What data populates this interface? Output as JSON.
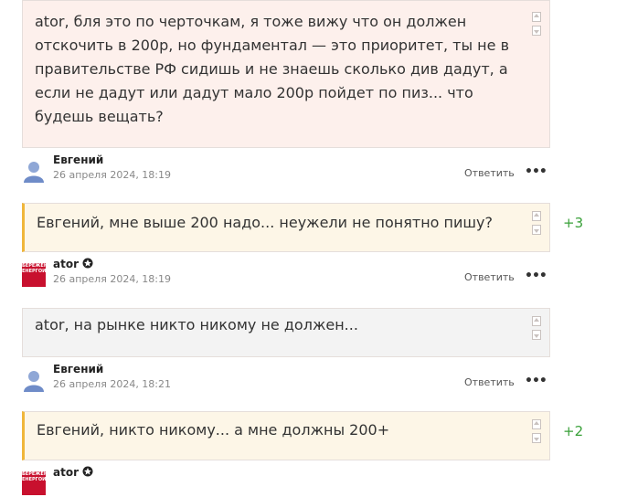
{
  "comments": [
    {
      "text_lines": [
        "ator, бля это по черточкам, я тоже вижу что он должен",
        "отскочить в 200р, но фундаментал — это приоритет, ты не в",
        "правительстве РФ сидишь и не знаешь сколько див дадут, а",
        "если не дадут или дадут мало  200р пойдет по пиз... что",
        "будешь вещать?"
      ],
      "author": "Евгений",
      "date": "26 апреля 2024, 18:19",
      "reply": "Ответить",
      "more": "•••"
    },
    {
      "text_lines": [
        "Евгений, мне выше 200 надо... неужели не понятно пишу?"
      ],
      "score": "+3",
      "author": "ator",
      "date": "26 апреля 2024, 18:19",
      "reply": "Ответить",
      "more": "•••"
    },
    {
      "text_lines": [
        "ator, на рынке никто никому не должен..."
      ],
      "author": "Евгений",
      "date": "26 апреля 2024, 18:21",
      "reply": "Ответить",
      "more": "•••"
    },
    {
      "text_lines": [
        "Евгений, никто никому... а мне должны 200+"
      ],
      "score": "+2",
      "author": "ator"
    }
  ],
  "avatar_logo_text": "БЕРЕЖЕНИ ЕНЕРГОИТ",
  "colors": {
    "score": "#3aa13a",
    "accent": "#f0b63a",
    "pink_bg": "#fdf0ec"
  }
}
